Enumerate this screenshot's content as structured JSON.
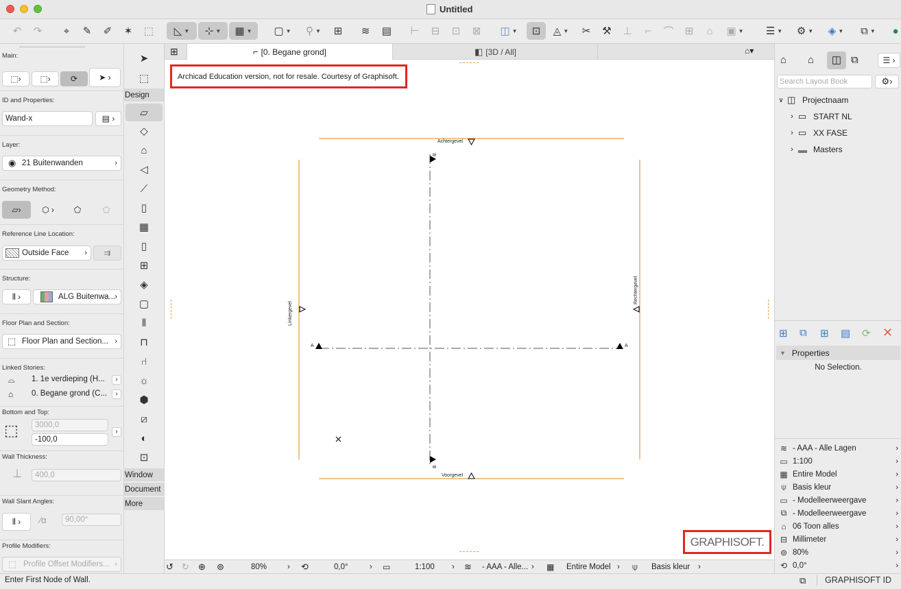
{
  "window": {
    "title": "Untitled"
  },
  "info_box": {
    "main_label": "Main:",
    "id_label": "ID and Properties:",
    "id_value": "Wand-x",
    "layer_label": "Layer:",
    "layer_value": "21 Buitenwanden",
    "geometry_label": "Geometry Method:",
    "refline_label": "Reference Line Location:",
    "refline_value": "Outside Face",
    "structure_label": "Structure:",
    "structure_value": "ALG Buitenwa...",
    "floorplan_label": "Floor Plan and Section:",
    "floorplan_value": "Floor Plan and Section...",
    "linked_label": "Linked Stories:",
    "linked_top": "1. 1e verdieping (H...",
    "linked_bottom": "0. Begane grond (C...",
    "bottomtop_label": "Bottom and Top:",
    "top_value": "3000,0",
    "bottom_value": "-100,0",
    "thickness_label": "Wall Thickness:",
    "thickness_value": "400,0",
    "slant_label": "Wall Slant Angles:",
    "slant_value": "90,00°",
    "profile_label": "Profile Modifiers:",
    "profile_value": "Profile Offset Modifiers..."
  },
  "toolbox": {
    "categories": {
      "design": "Design",
      "window": "Window",
      "document": "Document",
      "more": "More"
    }
  },
  "tabs": [
    {
      "label": "[0. Begane grond]",
      "active": true
    },
    {
      "label": "[3D / All]",
      "active": false
    }
  ],
  "canvas": {
    "watermark": "Archicad Education version, not for resale. Courtesy of Graphisoft.",
    "logo": "GRAPHISOFT.",
    "markers": {
      "achtergevel": "Achtergevel",
      "voorgevel": "Voorgevel",
      "linkergevel": "Linkergevel",
      "rechtergevel": "Rechtergevel",
      "section_a": "A",
      "section_b": "B"
    },
    "accent_color": "#e8a040"
  },
  "statusbar": {
    "zoom": "80%",
    "angle": "0,0°",
    "scale": "1:100",
    "layers": "- AAA - Alle...",
    "model": "Entire Model",
    "pen": "Basis kleur"
  },
  "right_panel": {
    "search_placeholder": "Search Layout Book",
    "tree": [
      {
        "label": "Projectnaam"
      },
      {
        "label": "START NL"
      },
      {
        "label": "XX FASE"
      },
      {
        "label": "Masters"
      }
    ],
    "properties_header": "Properties",
    "no_selection": "No Selection.",
    "quick_options": [
      {
        "label": "- AAA - Alle Lagen",
        "icon": "layers-icon"
      },
      {
        "label": "1:100",
        "icon": "scale-icon"
      },
      {
        "label": "Entire Model",
        "icon": "model-view-icon"
      },
      {
        "label": "Basis kleur",
        "icon": "pen-set-icon"
      },
      {
        "label": "- Modelleerweergave",
        "icon": "model-display-icon"
      },
      {
        "label": "- Modelleerweergave",
        "icon": "override-icon"
      },
      {
        "label": "06 Toon alles",
        "icon": "renovation-icon"
      },
      {
        "label": "Millimeter",
        "icon": "dimension-icon"
      },
      {
        "label": "80%",
        "icon": "zoom-icon"
      },
      {
        "label": "0,0°",
        "icon": "rotation-icon"
      }
    ]
  },
  "bottom_bar": {
    "prompt": "Enter First Node of Wall.",
    "graphisoft_id": "GRAPHISOFT ID"
  }
}
